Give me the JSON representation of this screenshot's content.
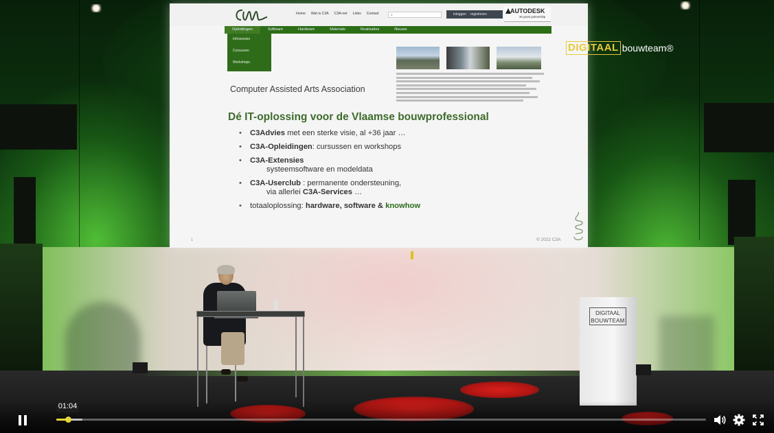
{
  "slide": {
    "site_nav": [
      "Home",
      "Wat is C3A",
      "C3A-net",
      "Links",
      "Contact"
    ],
    "login": [
      "inloggen",
      "registreren"
    ],
    "partner": {
      "brand": "AUTODESK",
      "note": "36 years partnership"
    },
    "menu": [
      "Opleidingen",
      "Software",
      "Hardware",
      "Materials",
      "Realisaties",
      "Nieuws"
    ],
    "dropdown": [
      "Infosessies",
      "Cursussen",
      "Workshops"
    ],
    "association": "Computer Assisted Arts Association",
    "headline": "Dé IT-oplossing voor de Vlaamse bouwprofessional",
    "bullets": [
      {
        "bold": "C3Advies",
        "rest": " met een sterke visie, al +36 jaar …"
      },
      {
        "bold": "C3A-Opleidingen",
        "rest": ": cursussen en workshops"
      },
      {
        "bold": "C3A-Extensies",
        "line2": "systeemsoftware en modeldata"
      },
      {
        "bold": "C3A-Userclub",
        "rest": " : permanente ondersteuning,",
        "line2_prefix": "via allerlei ",
        "line2_bold": "C3A-Services",
        "line2_suffix": " …"
      },
      {
        "prefix": "totaaloplossing: ",
        "bold": "hardware, software & ",
        "green": "knowhow"
      }
    ],
    "page_number": "1",
    "copyright": "© 2022 C3A"
  },
  "overlay_logo": {
    "boxed": "DIGITAAL",
    "word": "bouwteam®"
  },
  "lectern": {
    "line1": "DIGITAAL",
    "line2": "BOUWTEAM"
  },
  "player": {
    "state": "paused",
    "time_tooltip": "01:04",
    "progress_played_fraction": 0.018,
    "progress_buffered_fraction": 0.04,
    "accent_color": "#e8d63a",
    "icons": [
      "pause-icon",
      "volume-icon",
      "settings-gear-icon",
      "fullscreen-icon"
    ]
  }
}
